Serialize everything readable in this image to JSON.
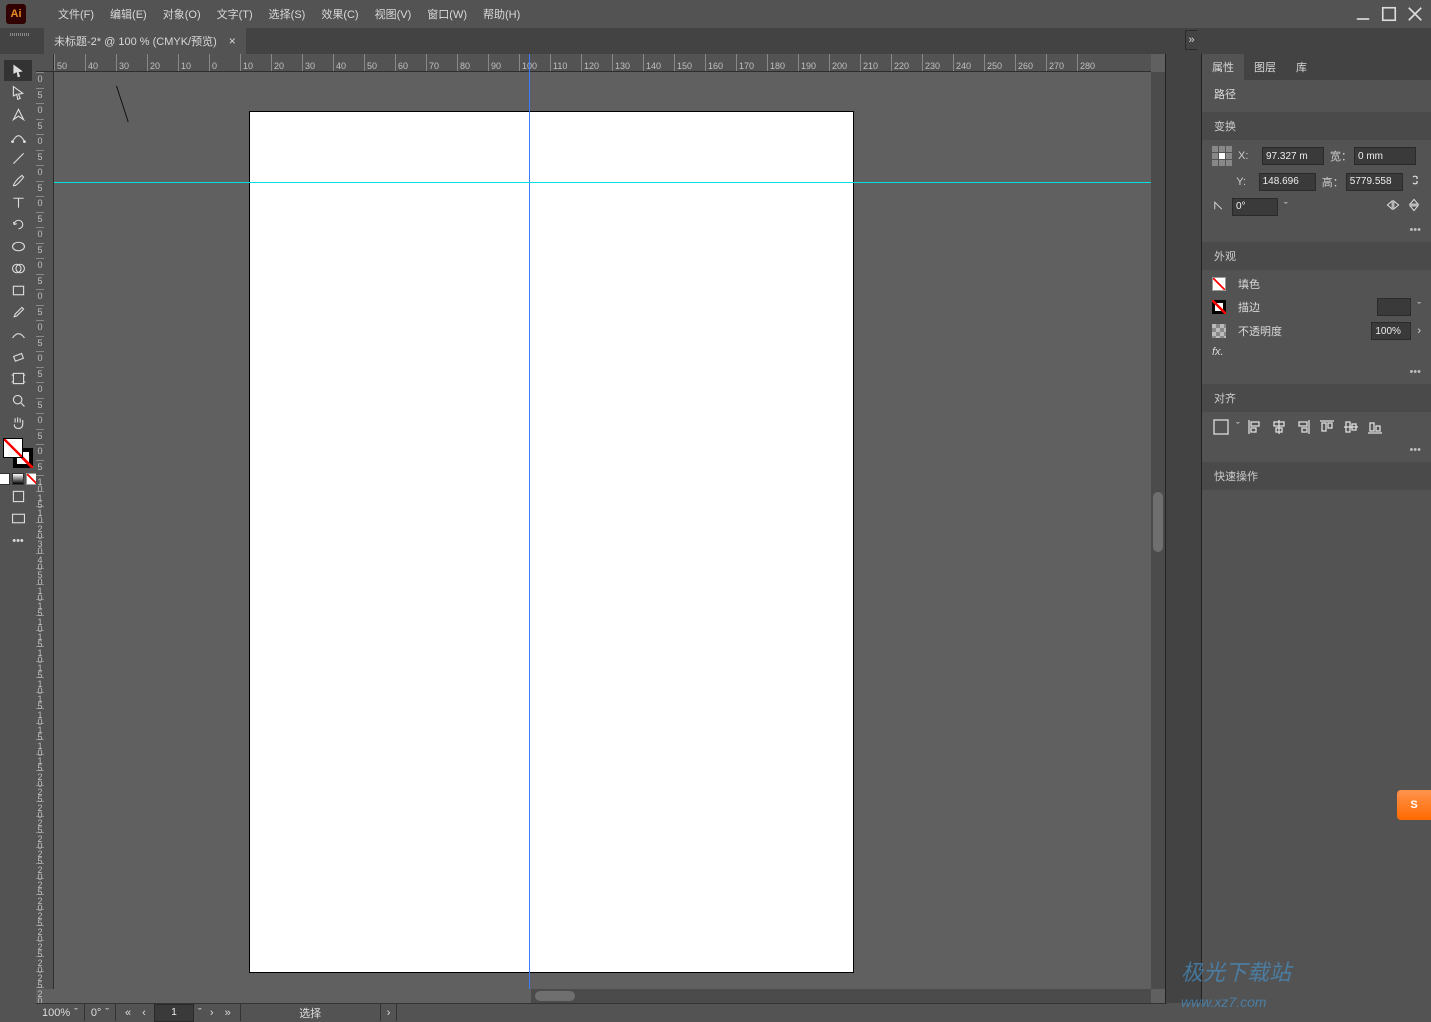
{
  "app": {
    "id": "Ai"
  },
  "menubar": {
    "items": [
      "文件(F)",
      "编辑(E)",
      "对象(O)",
      "文字(T)",
      "选择(S)",
      "效果(C)",
      "视图(V)",
      "窗口(W)",
      "帮助(H)"
    ]
  },
  "document_tab": {
    "title": "未标题-2* @ 100 % (CMYK/预览)",
    "close": "×"
  },
  "ruler_h": [
    "50",
    "40",
    "30",
    "20",
    "10",
    "0",
    "10",
    "20",
    "30",
    "40",
    "50",
    "60",
    "70",
    "80",
    "90",
    "100",
    "110",
    "120",
    "130",
    "140",
    "150",
    "160",
    "170",
    "180",
    "190",
    "200",
    "210",
    "220",
    "230",
    "240",
    "250",
    "260",
    "270",
    "280"
  ],
  "ruler_v": [
    "0",
    "5",
    "0",
    "5",
    "0",
    "5",
    "0",
    "5",
    "0",
    "5",
    "0",
    "5",
    "0",
    "5",
    "0",
    "5",
    "0",
    "5",
    "0",
    "5",
    "0",
    "5",
    "0",
    "5",
    "0",
    "5",
    "10",
    "15",
    "10",
    "20",
    "30",
    "40",
    "50",
    "10",
    "15",
    "10",
    "15",
    "10",
    "15",
    "10",
    "15",
    "10",
    "15",
    "10",
    "15",
    "20",
    "25",
    "20",
    "25",
    "20",
    "25",
    "20",
    "25",
    "20",
    "25",
    "20",
    "25",
    "20",
    "25",
    "20"
  ],
  "properties": {
    "tabs": {
      "properties": "属性",
      "layers": "图层",
      "libraries": "库"
    },
    "selection_label": "路径",
    "transform": {
      "header": "变换",
      "x_label": "X:",
      "x_value": "97.327 m",
      "y_label": "Y:",
      "y_value": "148.696",
      "w_label": "宽：",
      "w_value": "0 mm",
      "h_label": "高：",
      "h_value": "5779.558",
      "rotate_value": "0°"
    },
    "appearance": {
      "header": "外观",
      "fill_label": "填色",
      "stroke_label": "描边",
      "stroke_weight": "",
      "opacity_label": "不透明度",
      "opacity_value": "100%",
      "fx_label": "fx."
    },
    "align": {
      "header": "对齐"
    },
    "quick": {
      "header": "快速操作"
    }
  },
  "status": {
    "zoom": "100%",
    "rotate": "0°",
    "artboard_index": "1",
    "tool": "选择"
  },
  "more_glyph": "•••",
  "chevron_down": "ˇ",
  "chevron_right": "›",
  "chevron_left": "‹",
  "double_left": "«",
  "double_right": "»",
  "watermark_a": "极光下载站",
  "watermark_b": "www.xz7.com"
}
